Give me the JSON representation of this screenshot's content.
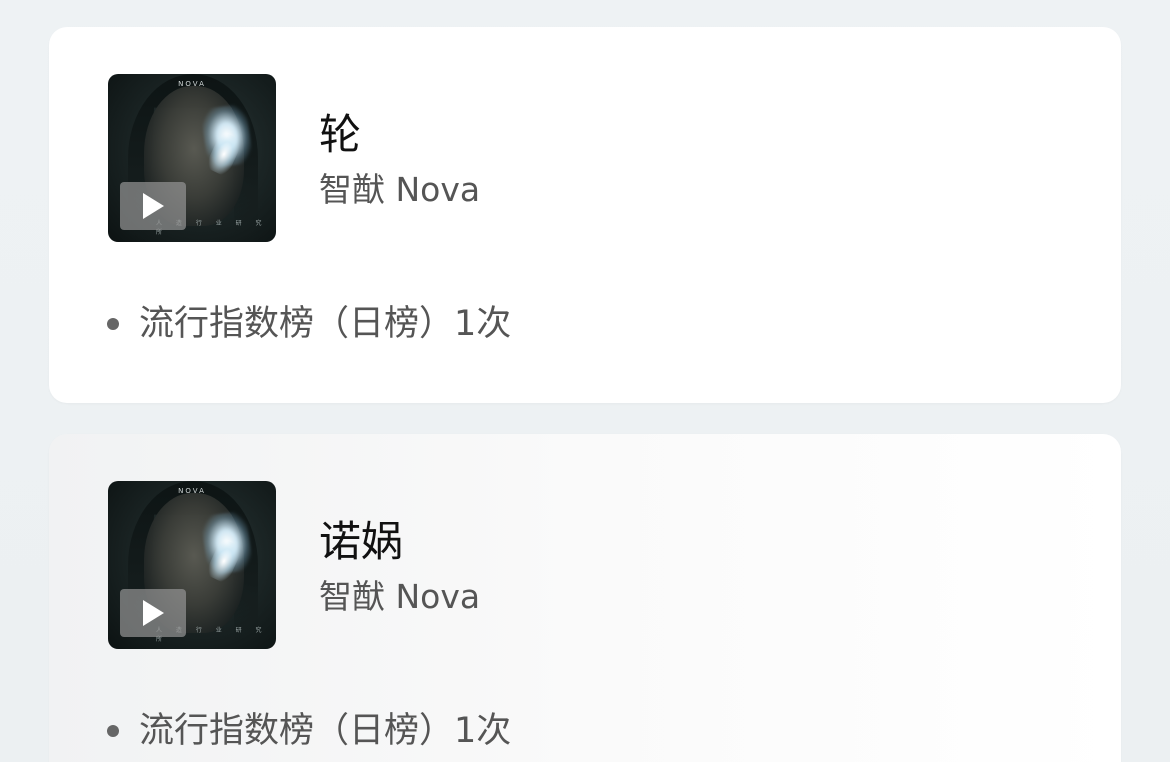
{
  "songs": [
    {
      "title": "轮",
      "artist": "智猷 Nova",
      "achievement": "流行指数榜（日榜）1次",
      "cover": {
        "top_text": "NOVA",
        "bottom_text": "人 造 行 业 研 究 所"
      },
      "play_icon": "play-icon"
    },
    {
      "title": "诺娲",
      "artist": "智猷 Nova",
      "achievement": "流行指数榜（日榜）1次",
      "cover": {
        "top_text": "NOVA",
        "bottom_text": "人 造 行 业 研 究 所"
      },
      "play_icon": "play-icon"
    }
  ],
  "colors": {
    "background": "#edf1f3",
    "card": "#ffffff",
    "title": "#111111",
    "secondary": "#555555"
  }
}
